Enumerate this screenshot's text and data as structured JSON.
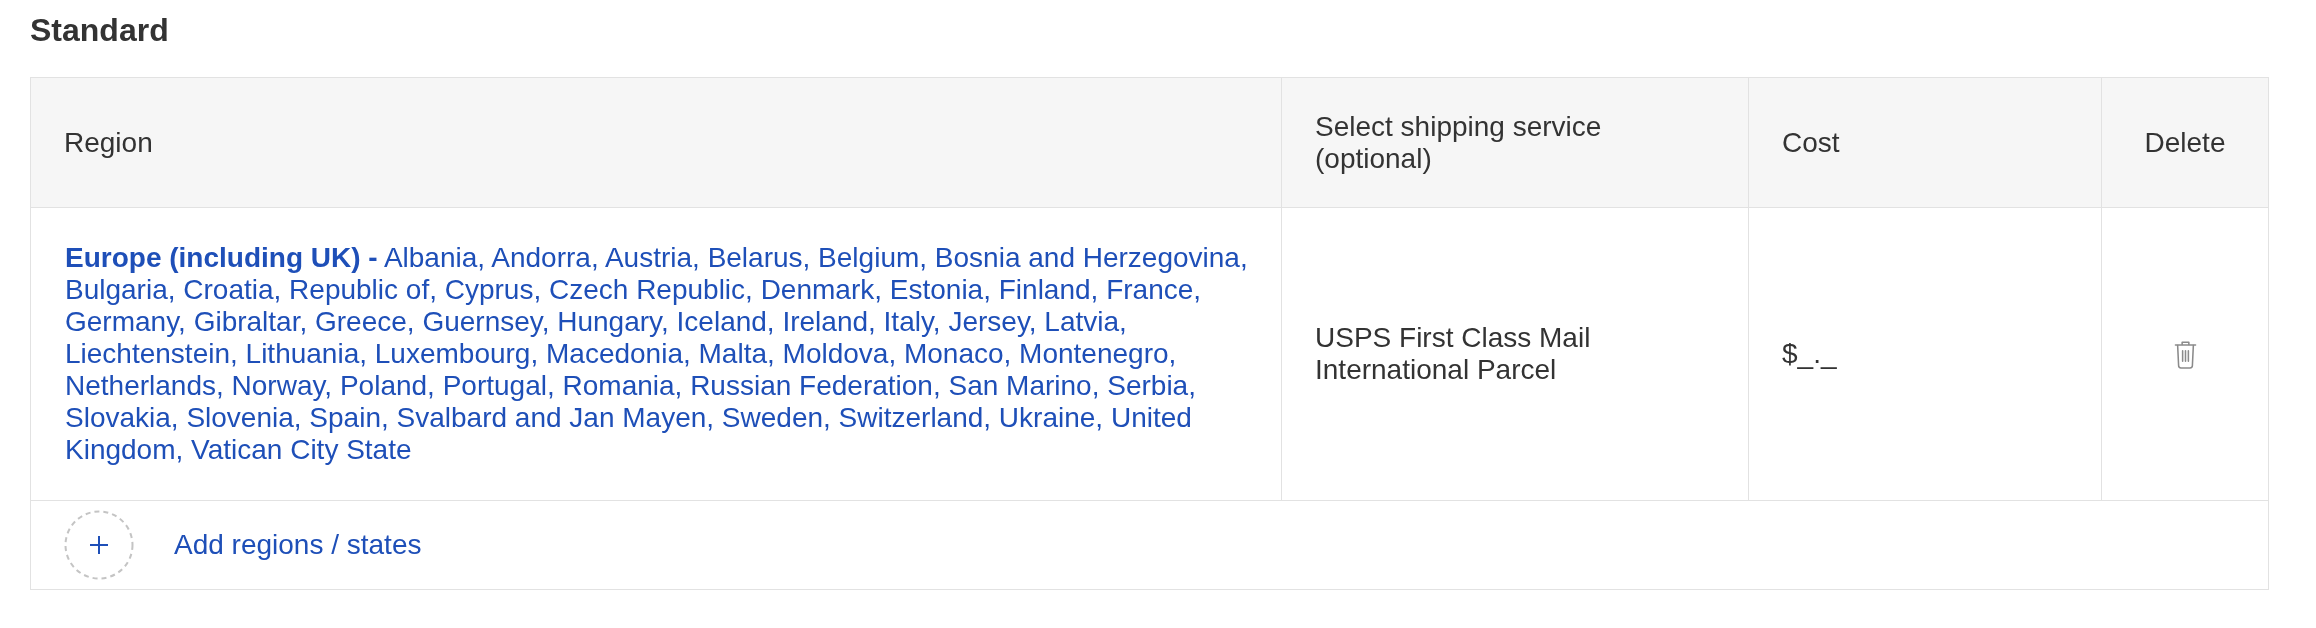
{
  "section": {
    "title": "Standard"
  },
  "table": {
    "columns": [
      "Region",
      "Select shipping service (optional)",
      "Cost",
      "Delete"
    ],
    "rows": [
      {
        "region": "**Europe (including UK) -** Albania, Andorra, Austria, Belarus, Belgium, Bosnia and Herzegovina, Bulgaria, Croatia, Republic of, Cyprus, Czech Republic, Denmark, Estonia, Finland, France, Germany, Gibraltar, Greece, Guernsey, Hungary, Iceland, Ireland, Italy, Jersey, Latvia, Liechtenstein, Lithuania, Luxembourg, Macedonia, Malta, Moldova, Monaco, Montenegro, Netherlands, Norway, Poland, Portugal, Romania, Russian Federation, San Marino, Serbia, Slovakia, Slovenia, Spain, Svalbard and Jan Mayen, Sweden, Switzerland, Ukraine, United Kingdom, Vatican City State",
        "shipping_service": "USPS First Class Mail International Parcel",
        "cost": "$_._"
      }
    ]
  },
  "add_button": {
    "label": "Add regions / states"
  }
}
